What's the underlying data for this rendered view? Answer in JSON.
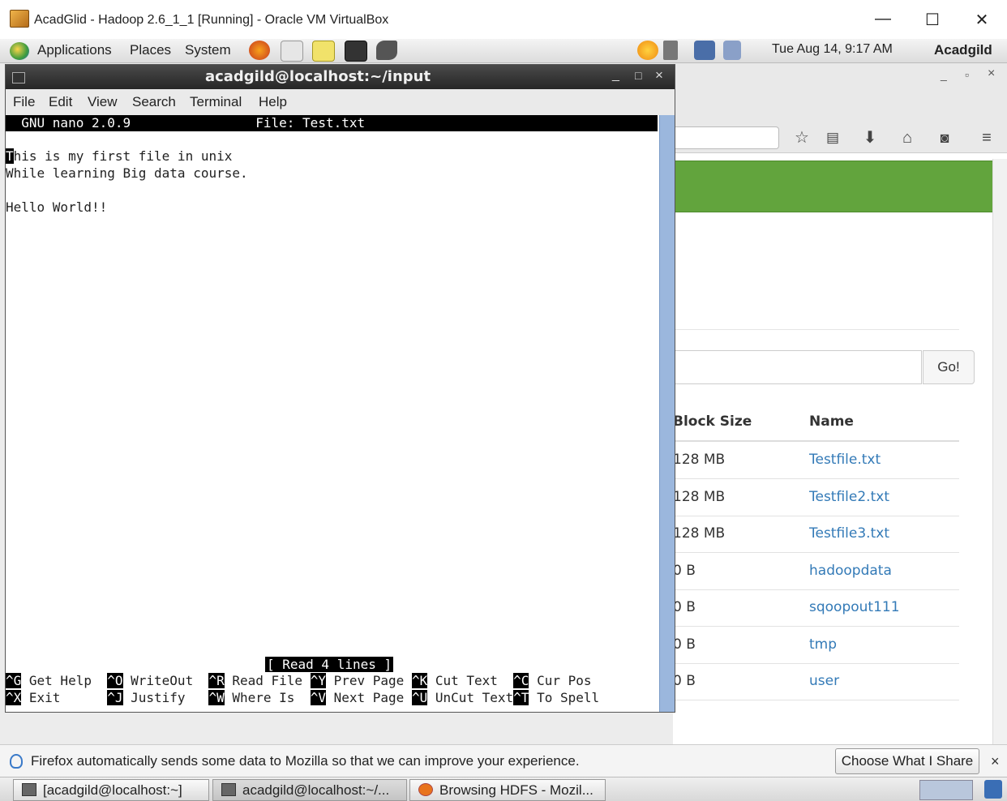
{
  "vbox": {
    "title": "AcadGlid - Hadoop 2.6_1_1 [Running] - Oracle VM VirtualBox",
    "minimize": "—",
    "maximize": "☐",
    "close": "✕"
  },
  "panel": {
    "menus": [
      "Applications",
      "Places",
      "System"
    ],
    "clock": "Tue Aug 14,  9:17 AM",
    "user": "Acadgild"
  },
  "terminal": {
    "title": "acadgild@localhost:~/input",
    "controls": {
      "minimize": "_",
      "maximize": "□",
      "close": "×"
    },
    "menu": [
      "File",
      "Edit",
      "View",
      "Search",
      "Terminal",
      "Help"
    ],
    "nano_header": "  GNU nano 2.0.9                File: Test.txt",
    "lines": [
      "This is my first file in unix",
      "While learning Big data course.",
      "",
      "Hello World!!"
    ],
    "status": "[ Read 4 lines ]",
    "shortcuts_row1": [
      {
        "key": "^G",
        "label": " Get Help  "
      },
      {
        "key": "^O",
        "label": " WriteOut  "
      },
      {
        "key": "^R",
        "label": " Read File "
      },
      {
        "key": "^Y",
        "label": " Prev Page "
      },
      {
        "key": "^K",
        "label": " Cut Text  "
      },
      {
        "key": "^C",
        "label": " Cur Pos"
      }
    ],
    "shortcuts_row2": [
      {
        "key": "^X",
        "label": " Exit      "
      },
      {
        "key": "^J",
        "label": " Justify   "
      },
      {
        "key": "^W",
        "label": " Where Is  "
      },
      {
        "key": "^V",
        "label": " Next Page "
      },
      {
        "key": "^U",
        "label": " UnCut Text"
      },
      {
        "key": "^T",
        "label": " To Spell"
      }
    ]
  },
  "firefox": {
    "controls": {
      "minimize": "_",
      "maximize": "▫",
      "close": "×"
    },
    "search_button": "Go!",
    "columns": {
      "block_size": "Block Size",
      "name": "Name"
    },
    "rows": [
      {
        "block_size": "128 MB",
        "name": "Testfile.txt"
      },
      {
        "block_size": "128 MB",
        "name": "Testfile2.txt"
      },
      {
        "block_size": "128 MB",
        "name": "Testfile3.txt"
      },
      {
        "block_size": "0 B",
        "name": "hadoopdata"
      },
      {
        "block_size": "0 B",
        "name": "sqoopout111"
      },
      {
        "block_size": "0 B",
        "name": "tmp"
      },
      {
        "block_size": "0 B",
        "name": "user"
      }
    ],
    "notification": "Firefox automatically sends some data to Mozilla so that we can improve your experience.",
    "notification_button": "Choose What I Share",
    "notification_close": "×"
  },
  "taskbar": {
    "items": [
      "[acadgild@localhost:~]",
      "acadgild@localhost:~/...",
      "Browsing HDFS - Mozil..."
    ]
  },
  "colors": {
    "firefox_header_green": "#62a43d",
    "link_blue": "#337ab7",
    "terminal_scroll": "#9bb7dd"
  }
}
